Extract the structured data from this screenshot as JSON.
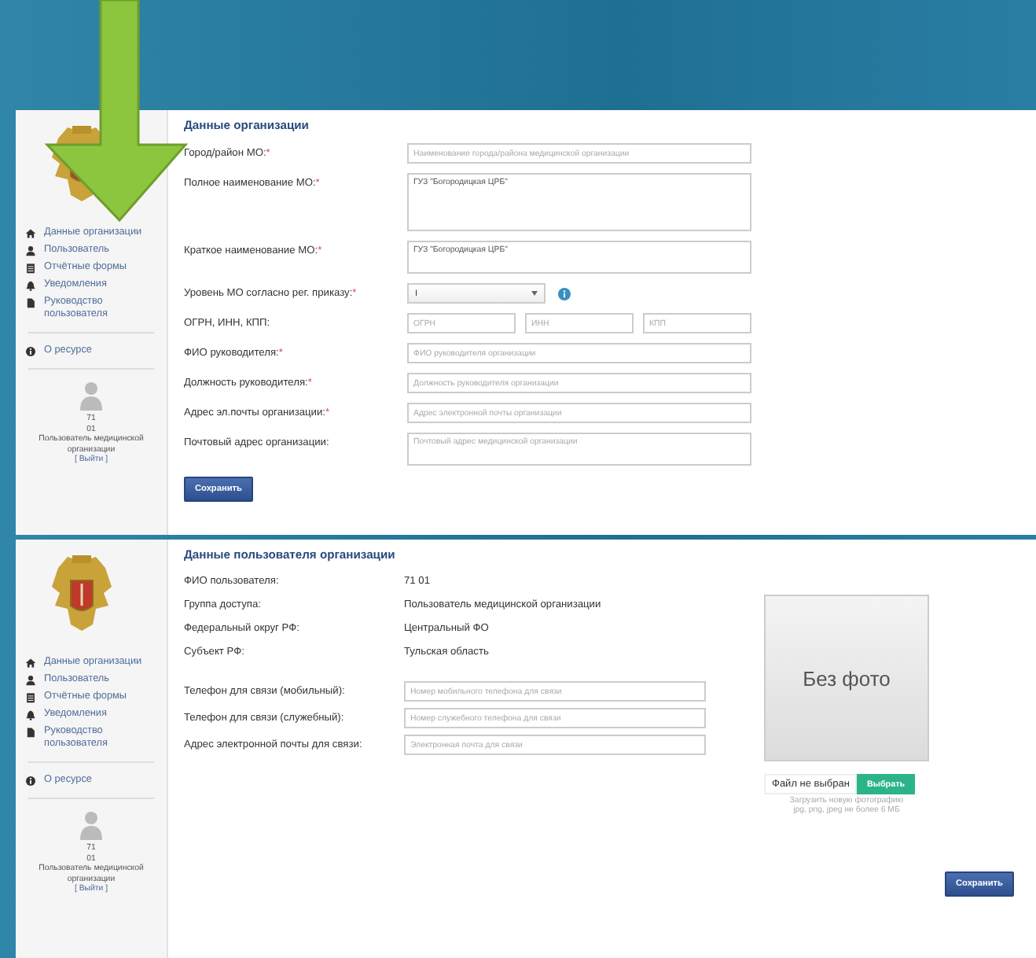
{
  "panels": [
    {
      "sidebar": {
        "nav": [
          {
            "label": "Данные организации"
          },
          {
            "label": "Пользователь"
          },
          {
            "label": "Отчётные формы"
          },
          {
            "label": "Уведомления"
          },
          {
            "label": "Руководство пользователя"
          }
        ],
        "about": {
          "label": "О ресурсе"
        },
        "user": {
          "line_1": "71",
          "line_2": "01",
          "role": "Пользователь медицинской организации",
          "logout": "[ Выйти ]"
        }
      },
      "title": "Данные организации",
      "fields": [
        {
          "kind": "text",
          "label": "Город/район МО:",
          "mark": "*",
          "placeholder": "Наименование города/района медицинской организации"
        },
        {
          "kind": "textarea",
          "label": "Полное наименование МО:",
          "mark": "*",
          "value": "ГУЗ \"Богородицкая ЦРБ\""
        },
        {
          "kind": "textbox",
          "label": "Краткое наименование МО:",
          "mark": "*",
          "value": "ГУЗ \"Богородицкая ЦРБ\""
        },
        {
          "kind": "select",
          "label": "Уровень МО согласно рег. приказу:",
          "mark": "*",
          "value": "I"
        },
        {
          "kind": "triple",
          "label": "ОГРН, ИНН, КПП:",
          "inputs": [
            {
              "placeholder": "ОГРН"
            },
            {
              "placeholder": "ИНН"
            },
            {
              "placeholder": "КПП"
            }
          ]
        },
        {
          "kind": "text",
          "label": "ФИО руководителя:",
          "mark": "*",
          "placeholder": "ФИО руководителя организации"
        },
        {
          "kind": "text",
          "label": "Должность руководителя:",
          "mark": "*",
          "placeholder": "Должность руководителя организации"
        },
        {
          "kind": "text",
          "label": "Адрес эл.почты организации:",
          "mark": "*",
          "placeholder": "Адрес электронной почты организации"
        },
        {
          "kind": "textbox",
          "label": "Почтовый адрес организации:",
          "placeholder": "Почтовый адрес медицинской организации"
        }
      ],
      "save": "Сохранить"
    },
    {
      "sidebar": {
        "nav": [
          {
            "label": "Данные организации"
          },
          {
            "label": "Пользователь"
          },
          {
            "label": "Отчётные формы"
          },
          {
            "label": "Уведомления"
          },
          {
            "label": "Руководство пользователя"
          }
        ],
        "about": {
          "label": "О ресурсе"
        },
        "user": {
          "line_1": "71",
          "line_2": "01",
          "role": "Пользователь медицинской организации",
          "logout": "[ Выйти ]"
        }
      },
      "title": "Данные пользователя организации",
      "fields": [
        {
          "kind": "info",
          "label": "ФИО пользователя:",
          "value": "71 01"
        },
        {
          "kind": "info",
          "label": "Группа доступа:",
          "value": "Пользователь медицинской организации"
        },
        {
          "kind": "info",
          "label": "Федеральный округ РФ:",
          "value": "Центральный ФО"
        },
        {
          "kind": "info",
          "label": "Субъект РФ:",
          "value": "Тульская область"
        },
        {
          "kind": "text",
          "label": "Телефон для связи (мобильный):",
          "placeholder": "Номер мобильного телефона для связи"
        },
        {
          "kind": "text",
          "label": "Телефон для связи (служебный):",
          "placeholder": "Номер служебного телефона для связи"
        },
        {
          "kind": "text",
          "label": "Адрес электронной почты для связи:",
          "placeholder": "Электронная почта для связи"
        }
      ],
      "photo": {
        "caption": "Без фото",
        "file_status": "Файл не выбран",
        "choose": "Выбрать",
        "hint_lines": [
          "Загрузить новую фотографию",
          "jpg, png, jpeg не более 6 МБ"
        ]
      },
      "save": "Сохранить"
    }
  ]
}
